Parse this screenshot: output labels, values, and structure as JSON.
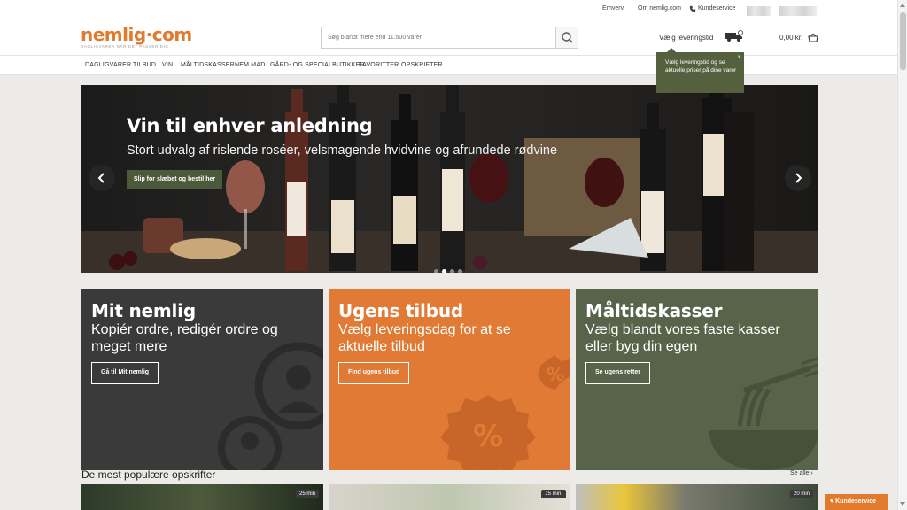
{
  "utility_bar": {
    "links": [
      "Erhverv",
      "Om nemlig.com",
      "Kundeservice"
    ]
  },
  "header": {
    "logo": "nemlig·com",
    "tagline": "DAGLIGVARER NÅR DET PASSER DIG",
    "search_placeholder": "Søg blandt mere end 11.500 varer",
    "delivery_label": "Vælg leveringstid",
    "cart_total": "0,00 kr."
  },
  "nav": {
    "items": [
      "DAGLIGVARER",
      "TILBUD",
      "VIN",
      "MÅLTIDSKASSER",
      "NEM MAD",
      "GÅRD- OG SPECIALBUTIKKER",
      "FAVORITTER",
      "OPSKRIFTER"
    ]
  },
  "tooltip": {
    "text": "Vælg leveringstid og se aktuelle priser på dine varer",
    "close": "×"
  },
  "hero": {
    "title": "Vin til enhver anledning",
    "subtitle": "Stort udvalg af rislende roséer, velsmagende hvidvine og afrundede rødvine",
    "cta": "Slip for slæbet og bestil her",
    "active_slide": 2,
    "total_slides": 4
  },
  "tiles": [
    {
      "title": "Mit nemlig",
      "description": "Kopiér ordre, redigér ordre og meget mere",
      "button": "Gå til Mit nemlig",
      "color": "#3a3a3a"
    },
    {
      "title": "Ugens tilbud",
      "description": "Vælg leveringsdag for at se aktuelle tilbud",
      "button": "Find ugens tilbud",
      "color": "#e07a35"
    },
    {
      "title": "Måltidskasser",
      "description": "Vælg blandt vores faste kasser eller byg din egen",
      "button": "Se ugens retter",
      "color": "#58644a"
    }
  ],
  "recipes": {
    "heading": "De mest populære opskrifter",
    "see_all": "Se alle",
    "cards": [
      {
        "time": "25 min"
      },
      {
        "time": "15 min."
      },
      {
        "time": "20 min"
      }
    ]
  },
  "support_button": "Kundeservice",
  "colors": {
    "brand_orange": "#e27a2e",
    "nav_green": "#4b5a3a",
    "tile_dark": "#3a3a3a",
    "tile_orange": "#e07a35",
    "tile_green": "#58644a"
  }
}
